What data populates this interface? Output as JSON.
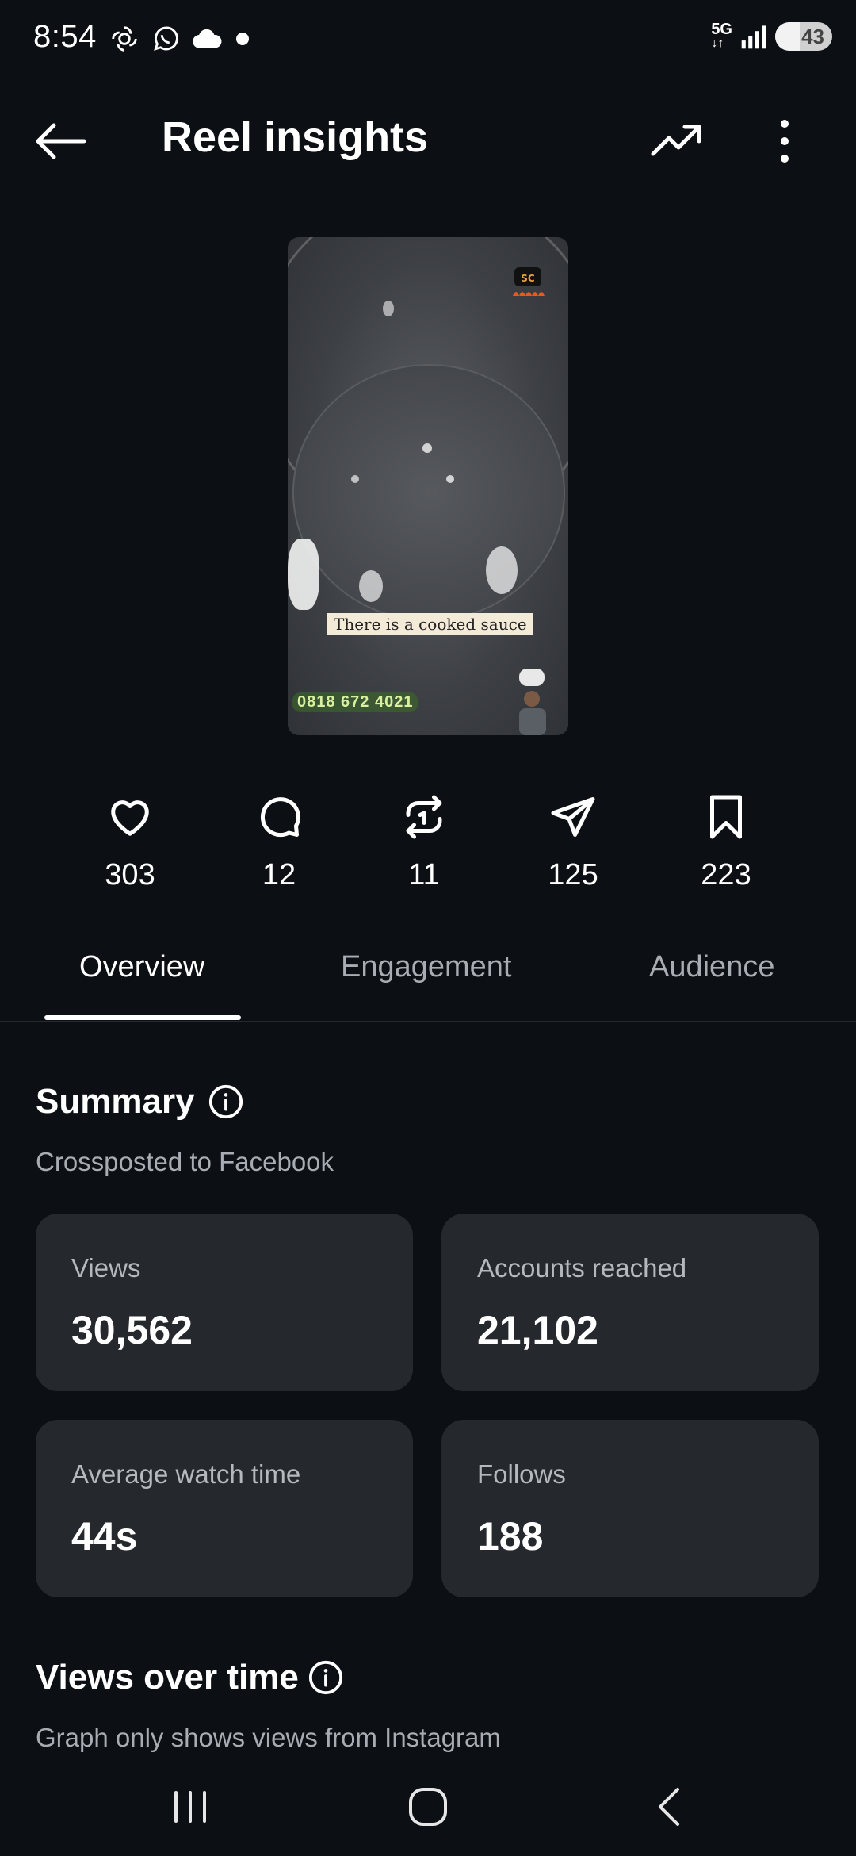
{
  "status_bar": {
    "time": "8:54",
    "network": "5G",
    "battery": "43",
    "battery_level": 0.43
  },
  "header": {
    "title": "Reel insights",
    "back_icon": "arrow-left-icon",
    "trend_icon": "trending-up-icon",
    "more_icon": "more-vertical-icon"
  },
  "thumbnail": {
    "caption": "There is a cooked sauce",
    "phone": "0818 672 4021"
  },
  "stats": [
    {
      "icon": "heart-icon",
      "value": "303"
    },
    {
      "icon": "comment-icon",
      "value": "12"
    },
    {
      "icon": "repost-icon",
      "value": "11"
    },
    {
      "icon": "share-icon",
      "value": "125"
    },
    {
      "icon": "bookmark-icon",
      "value": "223"
    }
  ],
  "tabs": [
    {
      "label": "Overview",
      "active": true
    },
    {
      "label": "Engagement",
      "active": false
    },
    {
      "label": "Audience",
      "active": false
    }
  ],
  "summary": {
    "title": "Summary",
    "subtitle": "Crossposted to Facebook",
    "cards": [
      {
        "label": "Views",
        "value": "30,562"
      },
      {
        "label": "Accounts reached",
        "value": "21,102"
      },
      {
        "label": "Average watch time",
        "value": "44s"
      },
      {
        "label": "Follows",
        "value": "188"
      }
    ]
  },
  "views_over_time": {
    "title": "Views over time",
    "subtitle": "Graph only shows views from Instagram"
  },
  "nav_bar": {
    "recents_icon": "recents-icon",
    "home_icon": "home-icon",
    "back_icon": "nav-back-icon"
  }
}
